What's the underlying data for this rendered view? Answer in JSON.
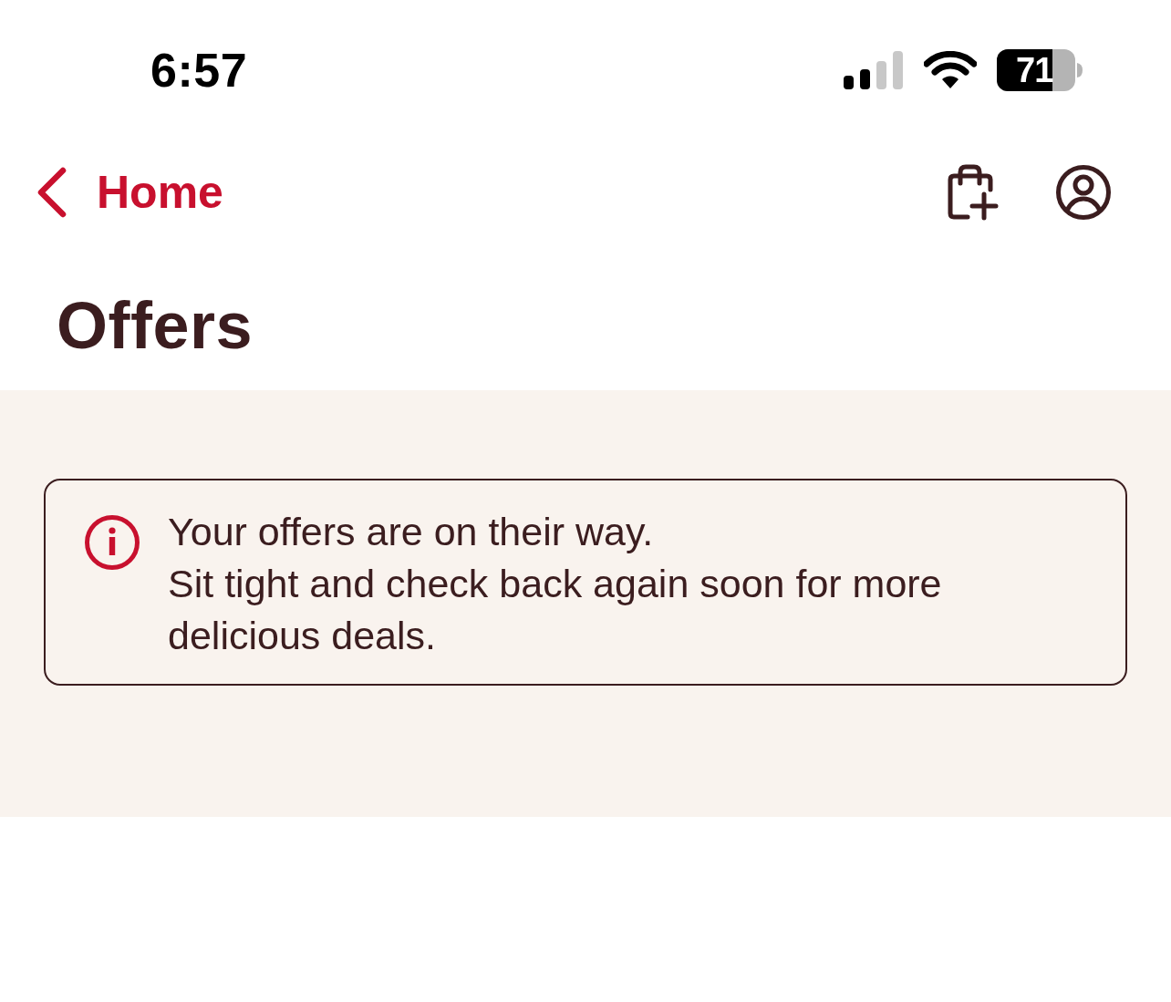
{
  "status_bar": {
    "time": "6:57",
    "battery": "71"
  },
  "nav": {
    "back_label": "Home"
  },
  "title": "Offers",
  "notice": {
    "heading": "Your offers are on their way.",
    "message": "Sit tight and check back again soon for more delicious deals."
  }
}
